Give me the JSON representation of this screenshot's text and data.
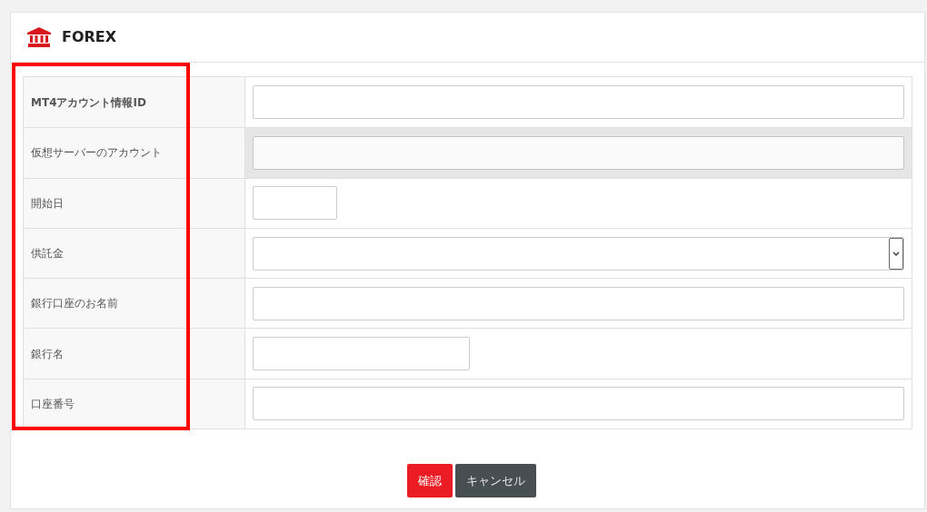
{
  "panel": {
    "title": "FOREX"
  },
  "highlight_labels": true,
  "rows": [
    {
      "label": "MT4アカウント情報ID",
      "bold": true,
      "kind": "text",
      "disabled": false
    },
    {
      "label": "仮想サーバーのアカウント",
      "bold": false,
      "kind": "text",
      "disabled": true
    },
    {
      "label": "開始日",
      "bold": false,
      "kind": "date",
      "disabled": false
    },
    {
      "label": "供託金",
      "bold": false,
      "kind": "select",
      "disabled": false
    },
    {
      "label": "銀行口座のお名前",
      "bold": false,
      "kind": "text",
      "disabled": false
    },
    {
      "label": "銀行名",
      "bold": false,
      "kind": "short",
      "disabled": false
    },
    {
      "label": "口座番号",
      "bold": false,
      "kind": "text",
      "disabled": false
    }
  ],
  "buttons": [
    {
      "label": "確認",
      "kind": "primary"
    },
    {
      "label": "キャンセル",
      "kind": "secondary"
    }
  ]
}
